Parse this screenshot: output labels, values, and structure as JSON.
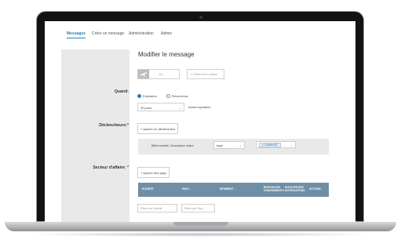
{
  "nav": {
    "items": [
      "Messages",
      "Créer un message",
      "Administration",
      "Admin"
    ]
  },
  "page": {
    "title": "Modifier le message"
  },
  "toggle": {
    "value": "Ko"
  },
  "checkbox": {
    "label": "Définir fiche unitaire"
  },
  "quand": {
    "label": "Quand:",
    "radio_options": [
      "Expiration",
      "Récurrence"
    ],
    "selected_radio": "Expiration",
    "select_value": "30 jours",
    "after_text": "Avant expiration"
  },
  "declencheurs": {
    "label": "Déclencheurs:",
    "required": "*",
    "add_button": "+ Ajouter un déclencheur",
    "row_label": "Billet invalidé, Description statut",
    "operator": "égal",
    "tag": "COMPLET"
  },
  "secteur": {
    "label": "Secteur d'affaire:",
    "required": "*",
    "add_button": "+ Ajouter des pays"
  },
  "table": {
    "headers": [
      "SOCIÉTÉ",
      "PAYS ↓",
      "RÉGIMENT ↓",
      "ÉDITION DES CHANGEMENTS",
      "ENVOYER DES NOTIFICATIONS",
      "ACTIONS"
    ]
  },
  "filters": {
    "societe_placeholder": "Filtrer par Société",
    "pays_placeholder": "Filtrer par Pays"
  },
  "colors": {
    "accent": "#2a7fb8",
    "table_header": "#6f8fa6",
    "panel_gray": "#e9e9e9",
    "required": "#d0021b"
  },
  "icons": {
    "toggle": "airplane-icon",
    "caret": "chevron-down-icon"
  }
}
